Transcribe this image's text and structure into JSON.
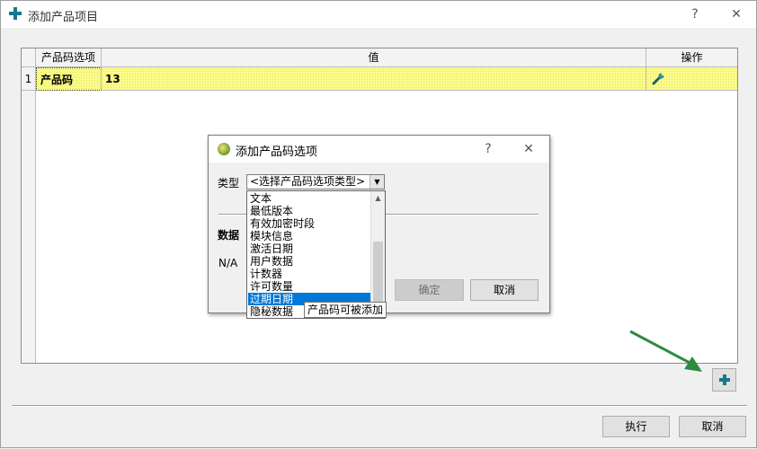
{
  "window": {
    "title": "添加产品项目",
    "help": "?",
    "close": "✕"
  },
  "grid": {
    "headers": [
      "产品码选项",
      "值",
      "操作"
    ],
    "rows": [
      {
        "index": "1",
        "option": "产品码",
        "value": "13"
      }
    ]
  },
  "buttons": {
    "execute": "执行",
    "cancel": "取消"
  },
  "dialog": {
    "title": "添加产品码选项",
    "help": "?",
    "close": "✕",
    "type_label": "类型",
    "combo_value": "<选择产品码选项类型>",
    "data_label": "数据",
    "na": "N/A",
    "ok": "确定",
    "cancel": "取消"
  },
  "dropdown": {
    "options": [
      "文本",
      "最低版本",
      "有效加密时段",
      "模块信息",
      "激活日期",
      "用户数据",
      "计数器",
      "许可数量",
      "过期日期",
      "隐秘数据"
    ],
    "selected": "过期日期"
  },
  "tooltip": "产品码可被添加",
  "colors": {
    "accent": "#157a8c",
    "selection": "#0078d7",
    "row_highlight": "#fafa8c",
    "arrow": "#2e8b3e"
  }
}
